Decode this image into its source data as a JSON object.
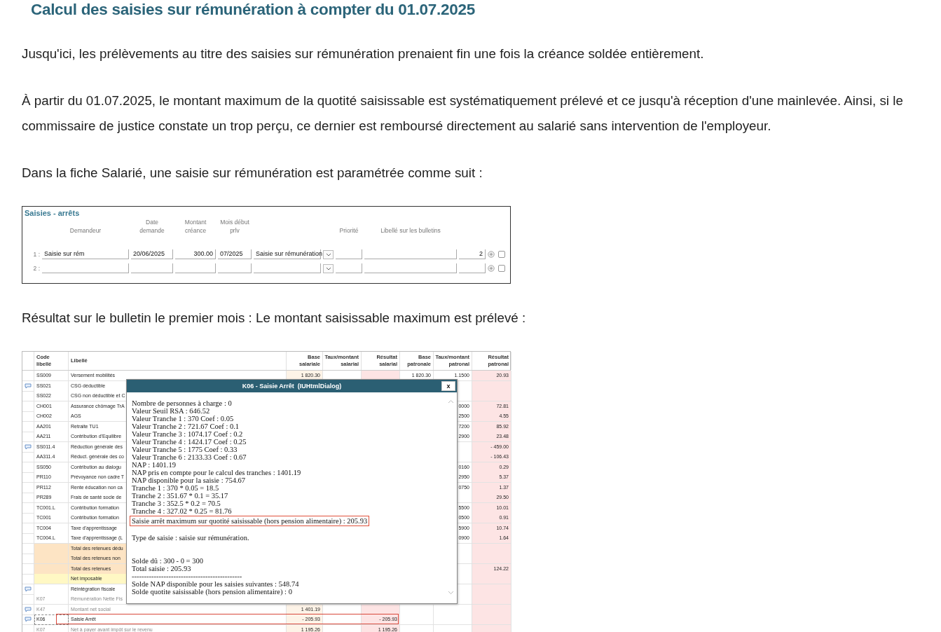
{
  "title": "Calcul des saisies sur rémunération à compter du 01.07.2025",
  "paragraphs_top": [
    "Jusqu'ici, les prélèvements au titre des saisies sur rémunération prenaient fin une fois la créance soldée entièrement.",
    "À partir du 01.07.2025, le montant maximum de la quotité saisissable est systématiquement prélevé et ce jusqu'à réception d'une mainlevée. Ainsi, si le commissaire de justice constate un trop perçu, ce dernier est remboursé directement au salarié sans intervention de l'employeur.",
    "Dans la fiche Salarié, une saisie sur rémunération est paramétrée comme suit :"
  ],
  "form": {
    "title": "Saisies - arrêts",
    "columns": [
      "Demandeur",
      "Date demande",
      "Montant créance",
      "Mois début prlv",
      "Priorité",
      "Libellé sur les bulletins"
    ],
    "rows": [
      {
        "index": "1 :",
        "demandeur": "Saisie sur rém",
        "date": "20/06/2025",
        "montant": "300.00",
        "mois": "07/2025",
        "type": "Saisie sur rémunération",
        "column_8": "2",
        "checked": false
      },
      {
        "index": "2 :",
        "checked": false
      }
    ]
  },
  "paragraph_bottom": "Résultat sur le bulletin le premier mois : Le montant saisissable maximum est prélevé :",
  "table": {
    "columns": [
      "Code libellé",
      "Libellé",
      "Base salariale",
      "Taux/montant salarial",
      "Résultat salarial",
      "Base patronale",
      "Taux/montant patronal",
      "Résultat patronal"
    ],
    "rows": [
      {
        "code": "SS009",
        "libelle": "Versement mobilités",
        "base_salariale": "1 820.30",
        "base_patronale": "1 820.30",
        "taux_patronal": "1.1500",
        "resultat_patronal": "20.93",
        "comment": false,
        "kind": "line",
        "highlighted": false
      },
      {
        "code": "SS021",
        "libelle": "CSG déductible",
        "comment": true,
        "kind": "line",
        "highlighted": false
      },
      {
        "code": "SS022",
        "libelle": "CSG non déductible et C",
        "comment": false,
        "kind": "line",
        "highlighted": false
      },
      {
        "code": "CH001",
        "libelle": "Assurance chômage TrA",
        "taux_patronal": "0000",
        "resultat_patronal": "72.81",
        "comment": false,
        "kind": "line",
        "highlighted": false
      },
      {
        "code": "CH002",
        "libelle": "AGS",
        "taux_patronal": "2500",
        "resultat_patronal": "4.55",
        "comment": false,
        "kind": "line",
        "highlighted": false
      },
      {
        "code": "AA201",
        "libelle": "Retraite TU1",
        "taux_patronal": "7200",
        "resultat_patronal": "85.92",
        "comment": false,
        "kind": "line",
        "highlighted": false
      },
      {
        "code": "AA211",
        "libelle": "Contribution d'Equilibre",
        "taux_patronal": "2900",
        "resultat_patronal": "23.48",
        "comment": false,
        "kind": "line",
        "highlighted": false
      },
      {
        "code": "SS011.4",
        "libelle": "Réduction générale des",
        "resultat_patronal": "- 459.00",
        "comment": true,
        "kind": "line",
        "highlighted": false
      },
      {
        "code": "AA311.4",
        "libelle": "Réduct. générale des co",
        "resultat_patronal": "- 106.43",
        "comment": false,
        "kind": "line",
        "highlighted": false
      },
      {
        "code": "SS050",
        "libelle": "Contribution au dialogu",
        "taux_patronal": "0160",
        "resultat_patronal": "0.29",
        "comment": false,
        "kind": "line",
        "highlighted": false
      },
      {
        "code": "PR110",
        "libelle": "Prévoyance non cadre T",
        "taux_patronal": "2950",
        "resultat_patronal": "5.37",
        "comment": false,
        "kind": "line",
        "highlighted": false
      },
      {
        "code": "PR112",
        "libelle": "Rente éducation non ca",
        "taux_patronal": "0750",
        "resultat_patronal": "1.37",
        "comment": false,
        "kind": "line",
        "highlighted": false
      },
      {
        "code": "PR289",
        "libelle": "Frais de santé socle de",
        "resultat_patronal": "29.50",
        "comment": false,
        "kind": "line",
        "highlighted": false
      },
      {
        "code": "TC001.L",
        "libelle": "Contribution formation",
        "taux_patronal": "5500",
        "resultat_patronal": "10.01",
        "comment": false,
        "kind": "line",
        "highlighted": false
      },
      {
        "code": "TC001",
        "libelle": "Contribution formation",
        "taux_patronal": "0500",
        "resultat_patronal": "0.91",
        "comment": false,
        "kind": "line",
        "highlighted": false
      },
      {
        "code": "TC004",
        "libelle": "Taxe d'apprentissage",
        "taux_patronal": "5900",
        "resultat_patronal": "10.74",
        "comment": false,
        "kind": "line",
        "highlighted": false
      },
      {
        "code": "TC004.L",
        "libelle": "Taxe d'apprentissage (L",
        "taux_patronal": "0900",
        "resultat_patronal": "1.64",
        "comment": false,
        "kind": "line",
        "highlighted": false
      },
      {
        "libelle": "Total des retenues dédu",
        "comment": false,
        "kind": "total",
        "highlighted": false
      },
      {
        "libelle": "Total des retenues non",
        "comment": false,
        "kind": "total",
        "highlighted": false
      },
      {
        "libelle": "Total des retenues",
        "resultat_patronal": "124.22",
        "comment": false,
        "kind": "total",
        "highlighted": false
      },
      {
        "libelle": "Net imposable",
        "comment": false,
        "kind": "net",
        "highlighted": false
      },
      {
        "libelle": "Réintégration fiscale",
        "comment": true,
        "kind": "line",
        "highlighted": false
      },
      {
        "code": "K07",
        "libelle": "Rémunération Nette Fis",
        "comment": false,
        "kind": "info",
        "highlighted": false
      },
      {
        "code": "K47",
        "libelle": "Montant net social",
        "base_salariale": "1 401.19",
        "comment": true,
        "kind": "info",
        "highlighted": false
      },
      {
        "code": "K06",
        "libelle": "Saisie Arrêt",
        "base_salariale": "- 205.93",
        "resultat_salarial": "- 205.93",
        "comment": true,
        "kind": "line",
        "highlighted": true
      },
      {
        "code": "K07",
        "libelle": "Net à payer avant impôt sur le revenu",
        "base_salariale": "1 195.26",
        "resultat_salarial": "1 195.26",
        "comment": false,
        "kind": "info",
        "highlighted": false
      }
    ]
  },
  "dialog": {
    "title": "K06 - Saisie Arrêt  (IUHtmlDialog)",
    "close": "x",
    "blocks": [
      [
        {
          "text": "Nombre de personnes à charge : 0",
          "boxed": false
        },
        {
          "text": "Valeur Seuil RSA : 646.52",
          "boxed": false
        },
        {
          "text": "Valeur Tranche 1 : 370 Coef : 0.05",
          "boxed": false
        },
        {
          "text": "Valeur Tranche 2 : 721.67 Coef : 0.1",
          "boxed": false
        },
        {
          "text": "Valeur Tranche 3 : 1074.17 Coef : 0.2",
          "boxed": false
        },
        {
          "text": "Valeur Tranche 4 : 1424.17 Coef : 0.25",
          "boxed": false
        },
        {
          "text": "Valeur Tranche 5 : 1775 Coef : 0.33",
          "boxed": false
        },
        {
          "text": "Valeur Tranche 6 : 2133.33 Coef : 0.67",
          "boxed": false
        },
        {
          "text": "NAP : 1401.19",
          "boxed": false
        },
        {
          "text": "NAP pris en compte pour le calcul des tranches : 1401.19",
          "boxed": false
        },
        {
          "text": "NAP disponible pour la saisie : 754.67",
          "boxed": false
        },
        {
          "text": "Tranche 1 : 370 * 0.05 = 18.5",
          "boxed": false
        },
        {
          "text": "Tranche 2 : 351.67 * 0.1 = 35.17",
          "boxed": false
        },
        {
          "text": "Tranche 3 : 352.5 * 0.2 = 70.5",
          "boxed": false
        },
        {
          "text": "Tranche 4 : 327.02 * 0.25 = 81.76",
          "boxed": false
        },
        {
          "text": "Saisie arrêt maximum sur quotité saisissable (hors pension alimentaire) : 205.93",
          "boxed": true
        }
      ],
      [
        {
          "text": "Type de saisie : saisie sur rémunération.",
          "boxed": false
        }
      ],
      [
        {
          "text": "Solde dû : 300 - 0 = 300",
          "boxed": false
        },
        {
          "text": "Total saisie : 205.93",
          "boxed": false
        },
        {
          "text": "---------------------------------------------",
          "boxed": false
        },
        {
          "text": "Solde NAP disponible pour les saisies suivantes : 548.74",
          "boxed": false
        },
        {
          "text": "Solde quotite saisissable (hors pension alimentaire) : 0",
          "boxed": false
        }
      ]
    ]
  }
}
